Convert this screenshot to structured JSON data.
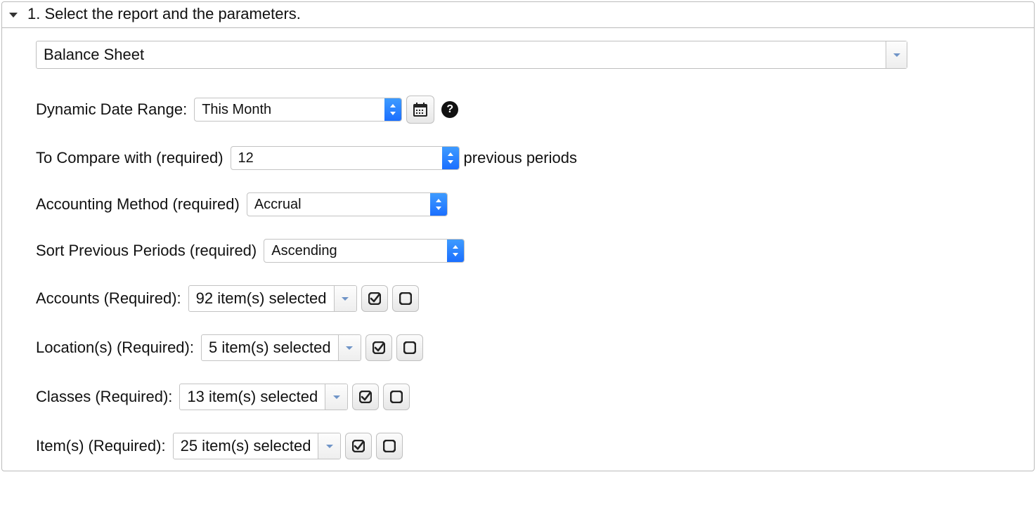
{
  "header": {
    "title": "1. Select the report and the parameters."
  },
  "report": {
    "selected": "Balance Sheet"
  },
  "date_range": {
    "label": "Dynamic Date Range:",
    "value": "This Month"
  },
  "compare": {
    "label_prefix": "To Compare with (required)",
    "value": "12",
    "label_suffix": "previous periods"
  },
  "accounting_method": {
    "label": "Accounting Method (required)",
    "value": "Accrual"
  },
  "sort_periods": {
    "label": "Sort Previous Periods (required)",
    "value": "Ascending"
  },
  "accounts": {
    "label": "Accounts (Required):",
    "summary": "92 item(s) selected"
  },
  "locations": {
    "label": "Location(s) (Required):",
    "summary": "5 item(s) selected"
  },
  "classes": {
    "label": "Classes (Required):",
    "summary": "13 item(s) selected"
  },
  "items": {
    "label": "Item(s) (Required):",
    "summary": "25 item(s) selected"
  },
  "help_glyph": "?"
}
